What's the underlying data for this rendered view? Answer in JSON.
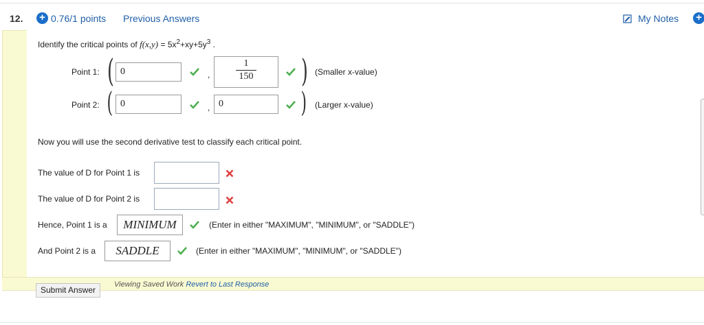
{
  "header": {
    "question_number": "12.",
    "points": "0.76/1 points",
    "previous_answers": "Previous Answers",
    "my_notes": "My Notes"
  },
  "prompt": {
    "lead": "Identify the critical points of ",
    "func": "f(x,y)",
    "eq": " = 5x",
    "exp1": "2",
    "mid": "+xy+5y",
    "exp2": "3",
    "end": " ."
  },
  "points": [
    {
      "label": "Point 1:",
      "x_value": "0",
      "y_value": {
        "numerator": "1",
        "denominator": "150"
      },
      "note": "(Smaller x-value)",
      "x_status": "correct",
      "y_status": "correct"
    },
    {
      "label": "Point 2:",
      "x_value": "0",
      "y_value": "0",
      "note": "(Larger x-value)",
      "x_status": "correct",
      "y_status": "correct"
    }
  ],
  "second_derivative_text": "Now you will use the second derivative test to classify each critical point.",
  "d_values": [
    {
      "label": "The value of D for Point 1 is",
      "value": "",
      "status": "incorrect"
    },
    {
      "label": "The value of D for Point 2 is",
      "value": "",
      "status": "incorrect"
    }
  ],
  "classify": [
    {
      "label": "Hence, Point 1 is a",
      "value": "MINIMUM",
      "status": "correct",
      "hint": "(Enter in either \"MAXIMUM\", \"MINIMUM\", or \"SADDLE\")"
    },
    {
      "label": "And Point 2 is a",
      "value": "SADDLE",
      "status": "correct",
      "hint": "(Enter in either \"MAXIMUM\", \"MINIMUM\", or \"SADDLE\")"
    }
  ],
  "footer": {
    "submit_label": "Submit Answer",
    "saved_text": "Viewing Saved Work ",
    "revert_link": "Revert to Last Response"
  },
  "colors": {
    "link": "#1f5fa8",
    "accent": "#1a6ec9",
    "correct": "#4caf50",
    "incorrect": "#e04040",
    "left_bar": "#fafad2"
  },
  "icons": [
    "plus-circle-icon",
    "notes-icon",
    "checkmark-icon",
    "x-mark-icon"
  ]
}
